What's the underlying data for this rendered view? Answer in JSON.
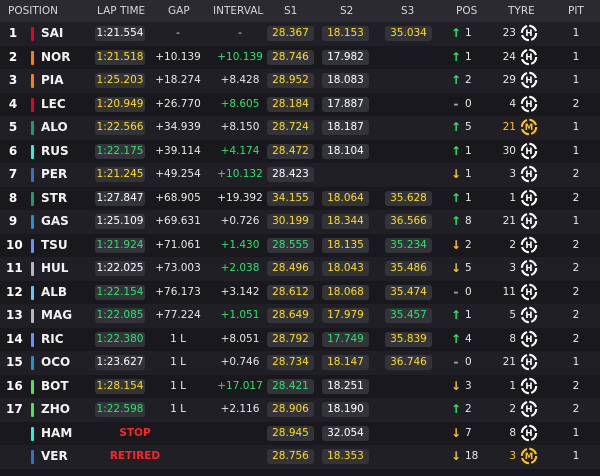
{
  "headers": {
    "position": "POSITION",
    "lap_time": "LAP TIME",
    "gap": "GAP",
    "interval": "INTERVAL",
    "s1": "S1",
    "s2": "S2",
    "s3": "S3",
    "pos": "POS",
    "tyre": "TYRE",
    "pit": "PIT"
  },
  "rows": [
    {
      "pos": "1",
      "driver": "SAI",
      "team_color": "#e8002d",
      "lap": "1:21.554",
      "lap_color": "w",
      "gap": "-",
      "interval": "-",
      "int_color": "w",
      "s1": "28.367",
      "s1c": "y",
      "s2": "18.153",
      "s2c": "y",
      "s3": "35.034",
      "s3c": "y",
      "arrow": "up",
      "change": "1",
      "tyre_age": "23",
      "tyre_age_color": "w",
      "tyre": "H",
      "pit": "1"
    },
    {
      "pos": "2",
      "driver": "NOR",
      "team_color": "#ff8000",
      "lap": "1:21.518",
      "lap_color": "y",
      "gap": "+10.139",
      "interval": "+10.139",
      "int_color": "g",
      "s1": "28.746",
      "s1c": "y",
      "s2": "17.982",
      "s2c": "w",
      "s3": "",
      "s3c": "w",
      "arrow": "up",
      "change": "1",
      "tyre_age": "24",
      "tyre_age_color": "w",
      "tyre": "H",
      "pit": "1"
    },
    {
      "pos": "3",
      "driver": "PIA",
      "team_color": "#ff8000",
      "lap": "1:25.203",
      "lap_color": "y",
      "gap": "+18.274",
      "interval": "+8.428",
      "int_color": "w",
      "s1": "28.952",
      "s1c": "y",
      "s2": "18.083",
      "s2c": "w",
      "s3": "",
      "s3c": "w",
      "arrow": "up",
      "change": "2",
      "tyre_age": "29",
      "tyre_age_color": "w",
      "tyre": "H",
      "pit": "1"
    },
    {
      "pos": "4",
      "driver": "LEC",
      "team_color": "#e8002d",
      "lap": "1:20.949",
      "lap_color": "y",
      "gap": "+26.770",
      "interval": "+8.605",
      "int_color": "g",
      "s1": "28.184",
      "s1c": "y",
      "s2": "17.887",
      "s2c": "w",
      "s3": "",
      "s3c": "w",
      "arrow": "none",
      "change": "0",
      "tyre_age": "4",
      "tyre_age_color": "w",
      "tyre": "H",
      "pit": "2"
    },
    {
      "pos": "5",
      "driver": "ALO",
      "team_color": "#229971",
      "lap": "1:22.566",
      "lap_color": "y",
      "gap": "+34.939",
      "interval": "+8.150",
      "int_color": "w",
      "s1": "28.724",
      "s1c": "y",
      "s2": "18.187",
      "s2c": "w",
      "s3": "",
      "s3c": "w",
      "arrow": "up",
      "change": "5",
      "tyre_age": "21",
      "tyre_age_color": "y",
      "tyre": "M",
      "pit": "1"
    },
    {
      "pos": "6",
      "driver": "RUS",
      "team_color": "#27f4d2",
      "lap": "1:22.175",
      "lap_color": "g",
      "gap": "+39.114",
      "interval": "+4.174",
      "int_color": "g",
      "s1": "28.472",
      "s1c": "y",
      "s2": "18.104",
      "s2c": "w",
      "s3": "",
      "s3c": "w",
      "arrow": "up",
      "change": "1",
      "tyre_age": "30",
      "tyre_age_color": "w",
      "tyre": "H",
      "pit": "1"
    },
    {
      "pos": "7",
      "driver": "PER",
      "team_color": "#3671c6",
      "lap": "1:21.245",
      "lap_color": "y",
      "gap": "+49.254",
      "interval": "+10.132",
      "int_color": "g",
      "s1": "28.423",
      "s1c": "w",
      "s2": "",
      "s2c": "w",
      "s3": "",
      "s3c": "w",
      "arrow": "down",
      "change": "1",
      "tyre_age": "3",
      "tyre_age_color": "w",
      "tyre": "H",
      "pit": "2"
    },
    {
      "pos": "8",
      "driver": "STR",
      "team_color": "#229971",
      "lap": "1:27.847",
      "lap_color": "w",
      "gap": "+68.905",
      "interval": "+19.392",
      "int_color": "w",
      "s1": "34.155",
      "s1c": "y",
      "s2": "18.064",
      "s2c": "y",
      "s3": "35.628",
      "s3c": "y",
      "arrow": "up",
      "change": "1",
      "tyre_age": "1",
      "tyre_age_color": "w",
      "tyre": "H",
      "pit": "2"
    },
    {
      "pos": "9",
      "driver": "GAS",
      "team_color": "#2293d1",
      "lap": "1:25.109",
      "lap_color": "w",
      "gap": "+69.631",
      "interval": "+0.726",
      "int_color": "w",
      "s1": "30.199",
      "s1c": "y",
      "s2": "18.344",
      "s2c": "y",
      "s3": "36.566",
      "s3c": "y",
      "arrow": "up",
      "change": "8",
      "tyre_age": "21",
      "tyre_age_color": "w",
      "tyre": "H",
      "pit": "1"
    },
    {
      "pos": "10",
      "driver": "TSU",
      "team_color": "#6692ff",
      "lap": "1:21.924",
      "lap_color": "g",
      "gap": "+71.061",
      "interval": "+1.430",
      "int_color": "g",
      "s1": "28.555",
      "s1c": "g",
      "s2": "18.135",
      "s2c": "y",
      "s3": "35.234",
      "s3c": "g",
      "arrow": "down",
      "change": "2",
      "tyre_age": "2",
      "tyre_age_color": "w",
      "tyre": "H",
      "pit": "2"
    },
    {
      "pos": "11",
      "driver": "HUL",
      "team_color": "#b6babd",
      "lap": "1:22.025",
      "lap_color": "w",
      "gap": "+73.003",
      "interval": "+2.038",
      "int_color": "g",
      "s1": "28.496",
      "s1c": "y",
      "s2": "18.043",
      "s2c": "y",
      "s3": "35.486",
      "s3c": "y",
      "arrow": "down",
      "change": "5",
      "tyre_age": "3",
      "tyre_age_color": "w",
      "tyre": "H",
      "pit": "2"
    },
    {
      "pos": "12",
      "driver": "ALB",
      "team_color": "#64c4ff",
      "lap": "1:22.154",
      "lap_color": "g",
      "gap": "+76.173",
      "interval": "+3.142",
      "int_color": "w",
      "s1": "28.612",
      "s1c": "y",
      "s2": "18.068",
      "s2c": "y",
      "s3": "35.474",
      "s3c": "y",
      "arrow": "none",
      "change": "0",
      "tyre_age": "11",
      "tyre_age_color": "w",
      "tyre": "H",
      "pit": "2"
    },
    {
      "pos": "13",
      "driver": "MAG",
      "team_color": "#b6babd",
      "lap": "1:22.085",
      "lap_color": "g",
      "gap": "+77.224",
      "interval": "+1.051",
      "int_color": "g",
      "s1": "28.649",
      "s1c": "y",
      "s2": "17.979",
      "s2c": "y",
      "s3": "35.457",
      "s3c": "g",
      "arrow": "up",
      "change": "1",
      "tyre_age": "5",
      "tyre_age_color": "w",
      "tyre": "H",
      "pit": "2"
    },
    {
      "pos": "14",
      "driver": "RIC",
      "team_color": "#6692ff",
      "lap": "1:22.380",
      "lap_color": "g",
      "gap": "1 L",
      "interval": "+8.051",
      "int_color": "w",
      "s1": "28.792",
      "s1c": "y",
      "s2": "17.749",
      "s2c": "g",
      "s3": "35.839",
      "s3c": "y",
      "arrow": "up",
      "change": "4",
      "tyre_age": "8",
      "tyre_age_color": "w",
      "tyre": "H",
      "pit": "2"
    },
    {
      "pos": "15",
      "driver": "OCO",
      "team_color": "#2293d1",
      "lap": "1:23.627",
      "lap_color": "w",
      "gap": "1 L",
      "interval": "+0.746",
      "int_color": "w",
      "s1": "28.734",
      "s1c": "y",
      "s2": "18.147",
      "s2c": "y",
      "s3": "36.746",
      "s3c": "y",
      "arrow": "none",
      "change": "0",
      "tyre_age": "21",
      "tyre_age_color": "w",
      "tyre": "H",
      "pit": "1"
    },
    {
      "pos": "16",
      "driver": "BOT",
      "team_color": "#52e252",
      "lap": "1:28.154",
      "lap_color": "y",
      "gap": "1 L",
      "interval": "+17.017",
      "int_color": "g",
      "s1": "28.421",
      "s1c": "g",
      "s2": "18.251",
      "s2c": "w",
      "s3": "",
      "s3c": "w",
      "arrow": "down",
      "change": "3",
      "tyre_age": "1",
      "tyre_age_color": "w",
      "tyre": "H",
      "pit": "2"
    },
    {
      "pos": "17",
      "driver": "ZHO",
      "team_color": "#52e252",
      "lap": "1:22.598",
      "lap_color": "g",
      "gap": "1 L",
      "interval": "+2.116",
      "int_color": "w",
      "s1": "28.906",
      "s1c": "y",
      "s2": "18.190",
      "s2c": "w",
      "s3": "",
      "s3c": "w",
      "arrow": "up",
      "change": "2",
      "tyre_age": "2",
      "tyre_age_color": "w",
      "tyre": "H",
      "pit": "2"
    },
    {
      "pos": "",
      "driver": "HAM",
      "team_color": "#27f4d2",
      "status": "STOP",
      "gap": "",
      "interval": "",
      "int_color": "w",
      "s1": "28.945",
      "s1c": "y",
      "s2": "32.054",
      "s2c": "w",
      "s3": "",
      "s3c": "w",
      "arrow": "down",
      "change": "7",
      "tyre_age": "8",
      "tyre_age_color": "w",
      "tyre": "H",
      "pit": "1"
    },
    {
      "pos": "",
      "driver": "VER",
      "team_color": "#3671c6",
      "status": "RETIRED",
      "gap": "",
      "interval": "",
      "int_color": "w",
      "s1": "28.756",
      "s1c": "y",
      "s2": "18.353",
      "s2c": "y",
      "s3": "",
      "s3c": "w",
      "arrow": "down",
      "change": "18",
      "tyre_age": "3",
      "tyre_age_color": "y",
      "tyre": "M",
      "pit": "1"
    }
  ]
}
